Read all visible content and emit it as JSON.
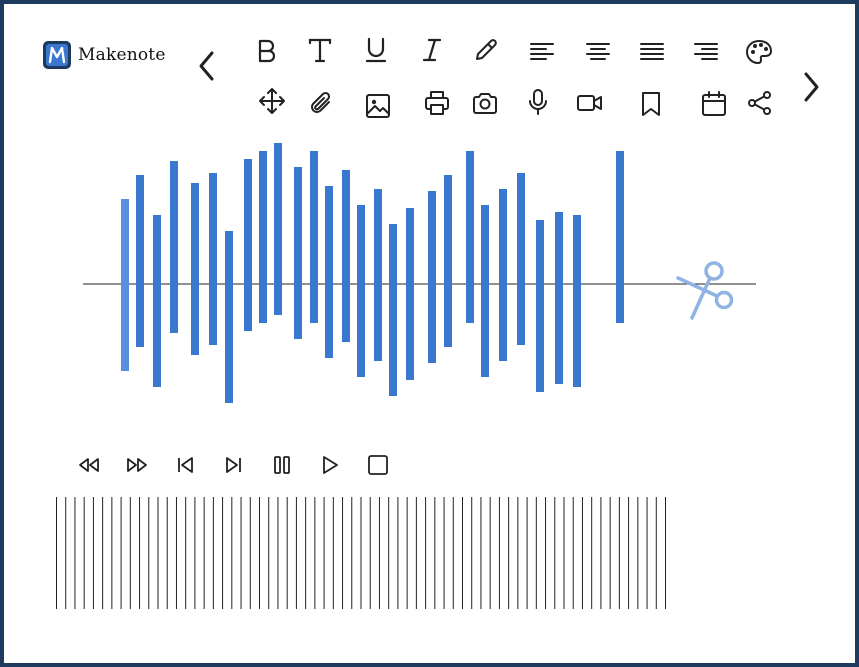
{
  "app": {
    "name": "Makenote",
    "accent": "#3a78d0",
    "frame_color": "#1f3a5f"
  },
  "toolbar": {
    "row1": [
      "bold-icon",
      "text-icon",
      "underline-icon",
      "italic-icon",
      "pen-icon",
      "align-left-icon",
      "align-center-icon",
      "align-justify-icon",
      "align-right-icon",
      "palette-icon"
    ],
    "row2": [
      "move-icon",
      "attachment-icon",
      "image-icon",
      "print-icon",
      "camera-icon",
      "microphone-icon",
      "video-icon",
      "bookmark-icon",
      "calendar-icon",
      "share-icon"
    ],
    "nav": [
      "chevron-left-icon",
      "chevron-right-icon"
    ]
  },
  "waveform": {
    "bar_color": "#3a78d0",
    "selected_bar_color": "#5a8ee0",
    "bar_count": 31,
    "tool": "scissors-icon",
    "tool_color": "#8fb3e3"
  },
  "playback": {
    "controls": [
      "rewind-icon",
      "fast-forward-icon",
      "skip-back-icon",
      "skip-forward-icon",
      "pause-icon",
      "play-icon",
      "stop-icon"
    ]
  },
  "timeline": {
    "tick_count": 67
  }
}
